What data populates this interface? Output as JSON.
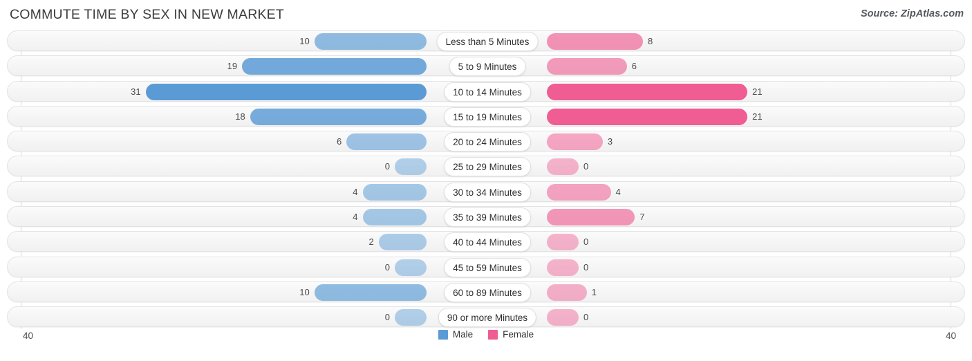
{
  "header": {
    "title": "COMMUTE TIME BY SEX IN NEW MARKET",
    "source": "Source: ZipAtlas.com"
  },
  "axis": {
    "left_label": "40",
    "right_label": "40",
    "max": 40
  },
  "legend": {
    "male_label": "Male",
    "female_label": "Female",
    "male_color": "#5b9bd5",
    "female_color": "#ef5d92"
  },
  "chart_data": {
    "type": "bar",
    "orientation": "horizontal-diverging",
    "title": "COMMUTE TIME BY SEX IN NEW MARKET",
    "xlabel": "",
    "ylabel": "",
    "xlim": [
      40,
      40
    ],
    "grid": true,
    "legend_position": "bottom-center",
    "categories": [
      "Less than 5 Minutes",
      "5 to 9 Minutes",
      "10 to 14 Minutes",
      "15 to 19 Minutes",
      "20 to 24 Minutes",
      "25 to 29 Minutes",
      "30 to 34 Minutes",
      "35 to 39 Minutes",
      "40 to 44 Minutes",
      "45 to 59 Minutes",
      "60 to 89 Minutes",
      "90 or more Minutes"
    ],
    "series": [
      {
        "name": "Male",
        "values": [
          10,
          19,
          31,
          18,
          6,
          0,
          4,
          4,
          2,
          0,
          10,
          0
        ]
      },
      {
        "name": "Female",
        "values": [
          8,
          6,
          21,
          21,
          3,
          0,
          4,
          7,
          0,
          0,
          1,
          0
        ]
      }
    ]
  },
  "rows": [
    {
      "label": "Less than 5 Minutes",
      "male": "10",
      "female": "8",
      "male_value": 10,
      "female_value": 8
    },
    {
      "label": "5 to 9 Minutes",
      "male": "19",
      "female": "6",
      "male_value": 19,
      "female_value": 6
    },
    {
      "label": "10 to 14 Minutes",
      "male": "31",
      "female": "21",
      "male_value": 31,
      "female_value": 21
    },
    {
      "label": "15 to 19 Minutes",
      "male": "18",
      "female": "21",
      "male_value": 18,
      "female_value": 21
    },
    {
      "label": "20 to 24 Minutes",
      "male": "6",
      "female": "3",
      "male_value": 6,
      "female_value": 3
    },
    {
      "label": "25 to 29 Minutes",
      "male": "0",
      "female": "0",
      "male_value": 0,
      "female_value": 0
    },
    {
      "label": "30 to 34 Minutes",
      "male": "4",
      "female": "4",
      "male_value": 4,
      "female_value": 4
    },
    {
      "label": "35 to 39 Minutes",
      "male": "4",
      "female": "7",
      "male_value": 4,
      "female_value": 7
    },
    {
      "label": "40 to 44 Minutes",
      "male": "2",
      "female": "0",
      "male_value": 2,
      "female_value": 0
    },
    {
      "label": "45 to 59 Minutes",
      "male": "0",
      "female": "0",
      "male_value": 0,
      "female_value": 0
    },
    {
      "label": "60 to 89 Minutes",
      "male": "10",
      "female": "1",
      "male_value": 10,
      "female_value": 1
    },
    {
      "label": "90 or more Minutes",
      "male": "0",
      "female": "0",
      "male_value": 0,
      "female_value": 0
    }
  ]
}
